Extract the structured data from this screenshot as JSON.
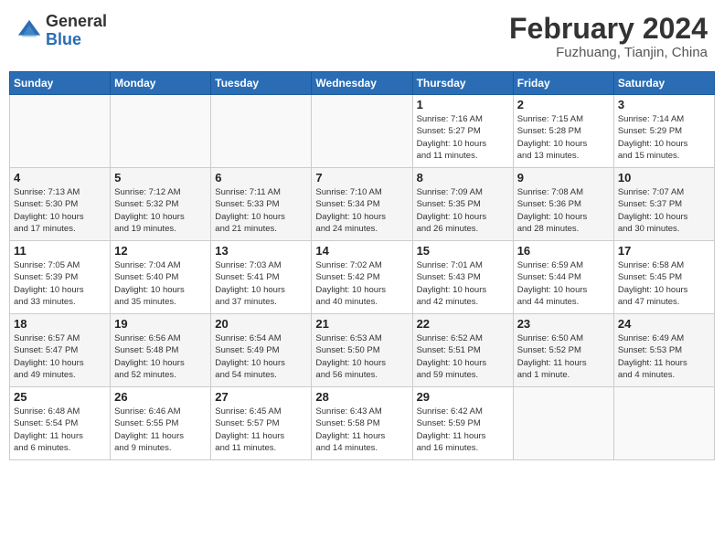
{
  "header": {
    "logo_general": "General",
    "logo_blue": "Blue",
    "month_title": "February 2024",
    "location": "Fuzhuang, Tianjin, China"
  },
  "columns": [
    "Sunday",
    "Monday",
    "Tuesday",
    "Wednesday",
    "Thursday",
    "Friday",
    "Saturday"
  ],
  "weeks": [
    [
      {
        "day": "",
        "info": ""
      },
      {
        "day": "",
        "info": ""
      },
      {
        "day": "",
        "info": ""
      },
      {
        "day": "",
        "info": ""
      },
      {
        "day": "1",
        "info": "Sunrise: 7:16 AM\nSunset: 5:27 PM\nDaylight: 10 hours\nand 11 minutes."
      },
      {
        "day": "2",
        "info": "Sunrise: 7:15 AM\nSunset: 5:28 PM\nDaylight: 10 hours\nand 13 minutes."
      },
      {
        "day": "3",
        "info": "Sunrise: 7:14 AM\nSunset: 5:29 PM\nDaylight: 10 hours\nand 15 minutes."
      }
    ],
    [
      {
        "day": "4",
        "info": "Sunrise: 7:13 AM\nSunset: 5:30 PM\nDaylight: 10 hours\nand 17 minutes."
      },
      {
        "day": "5",
        "info": "Sunrise: 7:12 AM\nSunset: 5:32 PM\nDaylight: 10 hours\nand 19 minutes."
      },
      {
        "day": "6",
        "info": "Sunrise: 7:11 AM\nSunset: 5:33 PM\nDaylight: 10 hours\nand 21 minutes."
      },
      {
        "day": "7",
        "info": "Sunrise: 7:10 AM\nSunset: 5:34 PM\nDaylight: 10 hours\nand 24 minutes."
      },
      {
        "day": "8",
        "info": "Sunrise: 7:09 AM\nSunset: 5:35 PM\nDaylight: 10 hours\nand 26 minutes."
      },
      {
        "day": "9",
        "info": "Sunrise: 7:08 AM\nSunset: 5:36 PM\nDaylight: 10 hours\nand 28 minutes."
      },
      {
        "day": "10",
        "info": "Sunrise: 7:07 AM\nSunset: 5:37 PM\nDaylight: 10 hours\nand 30 minutes."
      }
    ],
    [
      {
        "day": "11",
        "info": "Sunrise: 7:05 AM\nSunset: 5:39 PM\nDaylight: 10 hours\nand 33 minutes."
      },
      {
        "day": "12",
        "info": "Sunrise: 7:04 AM\nSunset: 5:40 PM\nDaylight: 10 hours\nand 35 minutes."
      },
      {
        "day": "13",
        "info": "Sunrise: 7:03 AM\nSunset: 5:41 PM\nDaylight: 10 hours\nand 37 minutes."
      },
      {
        "day": "14",
        "info": "Sunrise: 7:02 AM\nSunset: 5:42 PM\nDaylight: 10 hours\nand 40 minutes."
      },
      {
        "day": "15",
        "info": "Sunrise: 7:01 AM\nSunset: 5:43 PM\nDaylight: 10 hours\nand 42 minutes."
      },
      {
        "day": "16",
        "info": "Sunrise: 6:59 AM\nSunset: 5:44 PM\nDaylight: 10 hours\nand 44 minutes."
      },
      {
        "day": "17",
        "info": "Sunrise: 6:58 AM\nSunset: 5:45 PM\nDaylight: 10 hours\nand 47 minutes."
      }
    ],
    [
      {
        "day": "18",
        "info": "Sunrise: 6:57 AM\nSunset: 5:47 PM\nDaylight: 10 hours\nand 49 minutes."
      },
      {
        "day": "19",
        "info": "Sunrise: 6:56 AM\nSunset: 5:48 PM\nDaylight: 10 hours\nand 52 minutes."
      },
      {
        "day": "20",
        "info": "Sunrise: 6:54 AM\nSunset: 5:49 PM\nDaylight: 10 hours\nand 54 minutes."
      },
      {
        "day": "21",
        "info": "Sunrise: 6:53 AM\nSunset: 5:50 PM\nDaylight: 10 hours\nand 56 minutes."
      },
      {
        "day": "22",
        "info": "Sunrise: 6:52 AM\nSunset: 5:51 PM\nDaylight: 10 hours\nand 59 minutes."
      },
      {
        "day": "23",
        "info": "Sunrise: 6:50 AM\nSunset: 5:52 PM\nDaylight: 11 hours\nand 1 minute."
      },
      {
        "day": "24",
        "info": "Sunrise: 6:49 AM\nSunset: 5:53 PM\nDaylight: 11 hours\nand 4 minutes."
      }
    ],
    [
      {
        "day": "25",
        "info": "Sunrise: 6:48 AM\nSunset: 5:54 PM\nDaylight: 11 hours\nand 6 minutes."
      },
      {
        "day": "26",
        "info": "Sunrise: 6:46 AM\nSunset: 5:55 PM\nDaylight: 11 hours\nand 9 minutes."
      },
      {
        "day": "27",
        "info": "Sunrise: 6:45 AM\nSunset: 5:57 PM\nDaylight: 11 hours\nand 11 minutes."
      },
      {
        "day": "28",
        "info": "Sunrise: 6:43 AM\nSunset: 5:58 PM\nDaylight: 11 hours\nand 14 minutes."
      },
      {
        "day": "29",
        "info": "Sunrise: 6:42 AM\nSunset: 5:59 PM\nDaylight: 11 hours\nand 16 minutes."
      },
      {
        "day": "",
        "info": ""
      },
      {
        "day": "",
        "info": ""
      }
    ]
  ]
}
